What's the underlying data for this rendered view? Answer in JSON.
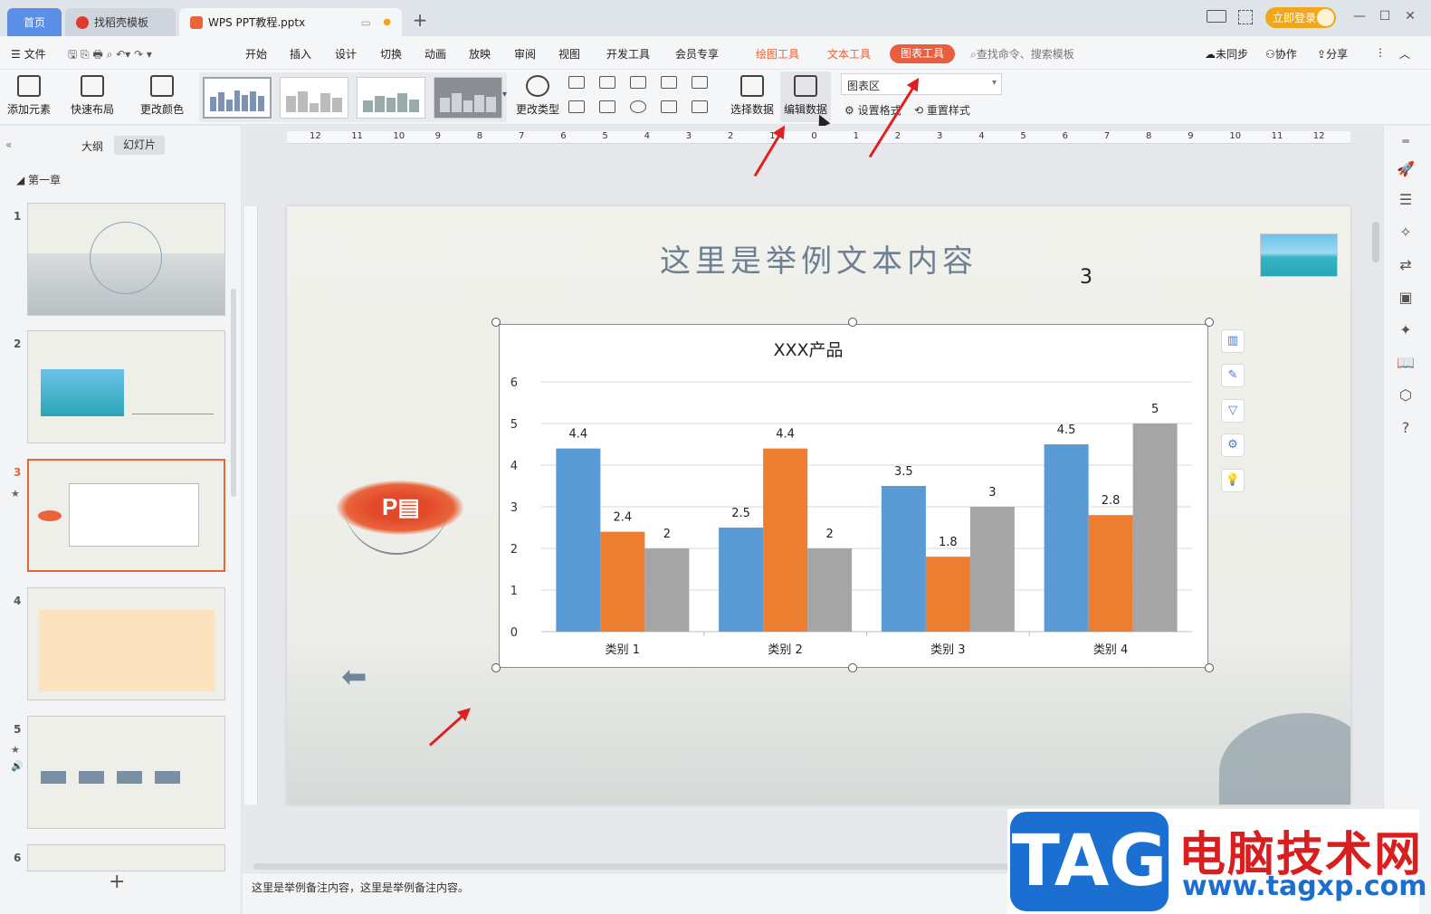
{
  "tabs": {
    "home": "首页",
    "templates": "找稻壳模板",
    "doc": "WPS PPT教程.pptx"
  },
  "titlebar": {
    "login": "立即登录"
  },
  "menu": {
    "file": "文件",
    "items": [
      "开始",
      "插入",
      "设计",
      "切换",
      "动画",
      "放映",
      "审阅",
      "视图",
      "开发工具",
      "会员专享"
    ],
    "draw_tools": "绘图工具",
    "text_tools": "文本工具",
    "chart_tools": "图表工具",
    "search": "查找命令、搜索模板",
    "sync": "未同步",
    "collab": "协作",
    "share": "分享"
  },
  "ribbon": {
    "add_element": "添加元素",
    "quick_layout": "快速布局",
    "change_color": "更改颜色",
    "change_type": "更改类型",
    "select_data": "选择数据",
    "edit_data": "编辑数据",
    "chart_area": "图表区",
    "set_format": "设置格式",
    "reset_style": "重置样式"
  },
  "left_panel": {
    "outline": "大纲",
    "slides": "幻灯片",
    "chapter": "第一章",
    "slide_numbers": [
      "1",
      "2",
      "3",
      "4",
      "5",
      "6"
    ]
  },
  "slide": {
    "title": "这里是举例文本内容",
    "number": "3"
  },
  "notes": "这里是举例备注内容，这里是举例备注内容。",
  "watermark": {
    "tag": "TAG",
    "cn": "电脑技术网",
    "url": "www.tagxp.com"
  },
  "colors": {
    "series1": "#5b9bd5",
    "series2": "#ed7d31",
    "series3": "#a5a5a5",
    "accent": "#ea5e3e"
  },
  "chart_data": {
    "type": "bar",
    "title": "XXX产品",
    "categories": [
      "类别 1",
      "类别 2",
      "类别 3",
      "类别 4"
    ],
    "series": [
      {
        "values": [
          4.4,
          2.5,
          3.5,
          4.5
        ]
      },
      {
        "values": [
          2.4,
          4.4,
          1.8,
          2.8
        ]
      },
      {
        "values": [
          2,
          2,
          3,
          5
        ]
      }
    ],
    "ylim": [
      0,
      6
    ],
    "yticks": [
      "0",
      "1",
      "2",
      "3",
      "4",
      "5",
      "6"
    ],
    "grid": true,
    "data_labels": true
  }
}
